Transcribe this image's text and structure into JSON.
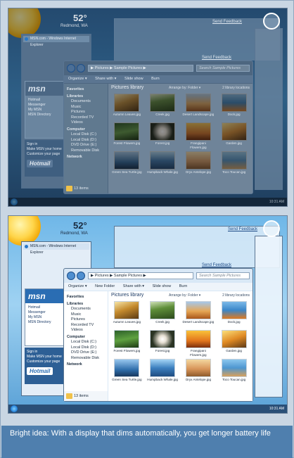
{
  "screenshots": [
    {
      "id": "dim",
      "weather": {
        "temp": "52°",
        "line1": "Redmond, WA",
        "line2": ""
      },
      "ie": {
        "tab_label": "MSN.com - Windows Internet Explorer"
      },
      "msn": {
        "logo": "msn",
        "links": [
          "Hotmail",
          "Messenger",
          "My MSN",
          "MSN Directory"
        ],
        "signin_title": "Sign in",
        "signin_sub": "Make MSN your home",
        "signin_sub2": "Customize your page",
        "hotmail": "Hotmail"
      },
      "explorer": {
        "address": "▶ Pictures ▶ Sample Pictures ▶",
        "search": "Search Sample Pictures",
        "toolbar": [
          "Organize ▾",
          "Share with ▾",
          "Slide show",
          "Burn"
        ],
        "library_title": "Pictures library",
        "arrange": "Arrange by: Folder ▾",
        "includes": "2 library locations",
        "items_count": "13 items"
      },
      "clock": "10:31 AM"
    },
    {
      "id": "bright",
      "weather": {
        "temp": "52°",
        "line1": "Redmond, WA",
        "line2": ""
      },
      "ie": {
        "tab_label": "MSN.com - Windows Internet Explorer"
      },
      "msn": {
        "logo": "msn",
        "links": [
          "Hotmail",
          "Messenger",
          "My MSN",
          "MSN Directory"
        ],
        "signin_title": "Sign in",
        "signin_sub": "Make MSN your home",
        "signin_sub2": "Customize your page",
        "hotmail": "Hotmail"
      },
      "explorer": {
        "address": "▶ Pictures ▶ Sample Pictures ▶",
        "search": "Search Sample Pictures",
        "toolbar": [
          "Organize ▾",
          "New Folder",
          "Share with ▾",
          "Slide show",
          "Burn"
        ],
        "library_title": "Pictures library",
        "arrange": "Arrange by: Folder ▾",
        "includes": "2 library locations",
        "items_count": "13 items"
      },
      "clock": "10:31 AM"
    }
  ],
  "send_feedback": "Send Feedback",
  "nav_pane": {
    "favorites": "Favorites",
    "libraries": "Libraries",
    "library_items": [
      "Documents",
      "Music",
      "Pictures",
      "Recorded TV",
      "Videos"
    ],
    "computer": "Computer",
    "computer_items": [
      "Local Disk (C:)",
      "Local Disk (D:)",
      "DVD Drive (E:)",
      "Removable Disk"
    ],
    "network": "Network"
  },
  "thumbnails": [
    {
      "label": "Autumn Leaves.jpg",
      "icon": "autumn-leaves-photo"
    },
    {
      "label": "Creek.jpg",
      "icon": "creek-photo"
    },
    {
      "label": "Desert Landscape.jpg",
      "icon": "desert-photo"
    },
    {
      "label": "Dock.jpg",
      "icon": "dock-photo"
    },
    {
      "label": "Forest Flowers.jpg",
      "icon": "forest-flowers-photo"
    },
    {
      "label": "Forest.jpg",
      "icon": "forest-photo"
    },
    {
      "label": "Frangipani Flowers.jpg",
      "icon": "frangipani-photo"
    },
    {
      "label": "Garden.jpg",
      "icon": "garden-photo"
    },
    {
      "label": "Green Sea Turtle.jpg",
      "icon": "turtle-photo"
    },
    {
      "label": "Humpback Whale.jpg",
      "icon": "whale-photo"
    },
    {
      "label": "Oryx Antelope.jpg",
      "icon": "oryx-photo"
    },
    {
      "label": "Toco Toucan.jpg",
      "icon": "toucan-photo"
    }
  ],
  "caption": "Bright idea: With a display that dims automatically, you get longer battery life"
}
